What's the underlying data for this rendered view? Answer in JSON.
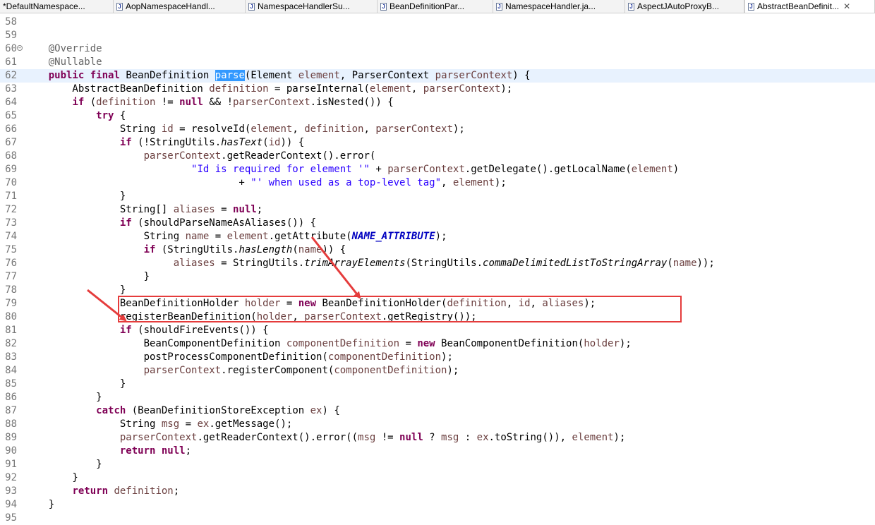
{
  "tabs": [
    {
      "label": "*DefaultNamespace...",
      "active": false,
      "icon": "java-file-icon"
    },
    {
      "label": "AopNamespaceHandl...",
      "active": false,
      "icon": "java-file-icon"
    },
    {
      "label": "NamespaceHandlerSu...",
      "active": false,
      "icon": "java-file-icon"
    },
    {
      "label": "BeanDefinitionPar...",
      "active": false,
      "icon": "java-file-icon"
    },
    {
      "label": "NamespaceHandler.ja...",
      "active": false,
      "icon": "java-file-icon"
    },
    {
      "label": "AspectJAutoProxyB...",
      "active": false,
      "icon": "java-file-icon"
    },
    {
      "label": "AbstractBeanDefinit...",
      "active": true,
      "icon": "java-file-icon",
      "close": "✕"
    }
  ],
  "colors": {
    "keyword": "#7f0055",
    "annotation": "#646464",
    "string": "#2a00ff",
    "field_constant": "#0000c0",
    "selection": "#3399ff",
    "current_line": "#e8f2fe",
    "highlight_box": "#e53c3c",
    "arrow": "#e53c3c"
  },
  "fold_marker": {
    "line": "60",
    "glyph": "−"
  },
  "selected_token": "parse",
  "current_line": "62",
  "highlight_box_lines": [
    "79",
    "80"
  ],
  "code_lines": [
    {
      "n": "58",
      "segs": []
    },
    {
      "n": "59",
      "segs": []
    },
    {
      "n": "60",
      "segs": [
        {
          "t": "    "
        },
        {
          "t": "@Override",
          "c": "ann"
        }
      ]
    },
    {
      "n": "61",
      "segs": [
        {
          "t": "    "
        },
        {
          "t": "@Nullable",
          "c": "ann"
        }
      ]
    },
    {
      "n": "62",
      "segs": [
        {
          "t": "    "
        },
        {
          "t": "public",
          "c": "kw"
        },
        {
          "t": " "
        },
        {
          "t": "final",
          "c": "kw"
        },
        {
          "t": " BeanDefinition "
        },
        {
          "t": "parse",
          "c": "sel"
        },
        {
          "t": "(Element "
        },
        {
          "t": "element",
          "c": "vr"
        },
        {
          "t": ", ParserContext "
        },
        {
          "t": "parserContext",
          "c": "vr"
        },
        {
          "t": ") {"
        }
      ]
    },
    {
      "n": "63",
      "segs": [
        {
          "t": "        AbstractBeanDefinition "
        },
        {
          "t": "definition",
          "c": "vr"
        },
        {
          "t": " = parseInternal("
        },
        {
          "t": "element",
          "c": "vr"
        },
        {
          "t": ", "
        },
        {
          "t": "parserContext",
          "c": "vr"
        },
        {
          "t": ");"
        }
      ]
    },
    {
      "n": "64",
      "segs": [
        {
          "t": "        "
        },
        {
          "t": "if",
          "c": "kw"
        },
        {
          "t": " ("
        },
        {
          "t": "definition",
          "c": "vr"
        },
        {
          "t": " != "
        },
        {
          "t": "null",
          "c": "kw"
        },
        {
          "t": " && !"
        },
        {
          "t": "parserContext",
          "c": "vr"
        },
        {
          "t": ".isNested()) {"
        }
      ]
    },
    {
      "n": "65",
      "segs": [
        {
          "t": "            "
        },
        {
          "t": "try",
          "c": "kw"
        },
        {
          "t": " {"
        }
      ]
    },
    {
      "n": "66",
      "segs": [
        {
          "t": "                String "
        },
        {
          "t": "id",
          "c": "vr"
        },
        {
          "t": " = resolveId("
        },
        {
          "t": "element",
          "c": "vr"
        },
        {
          "t": ", "
        },
        {
          "t": "definition",
          "c": "vr"
        },
        {
          "t": ", "
        },
        {
          "t": "parserContext",
          "c": "vr"
        },
        {
          "t": ");"
        }
      ]
    },
    {
      "n": "67",
      "segs": [
        {
          "t": "                "
        },
        {
          "t": "if",
          "c": "kw"
        },
        {
          "t": " (!StringUtils."
        },
        {
          "t": "hasText",
          "c": "it"
        },
        {
          "t": "("
        },
        {
          "t": "id",
          "c": "vr"
        },
        {
          "t": ")) {"
        }
      ]
    },
    {
      "n": "68",
      "segs": [
        {
          "t": "                    "
        },
        {
          "t": "parserContext",
          "c": "vr"
        },
        {
          "t": ".getReaderContext().error("
        }
      ]
    },
    {
      "n": "69",
      "segs": [
        {
          "t": "                            "
        },
        {
          "t": "\"Id is required for element '\"",
          "c": "str"
        },
        {
          "t": " + "
        },
        {
          "t": "parserContext",
          "c": "vr"
        },
        {
          "t": ".getDelegate().getLocalName("
        },
        {
          "t": "element",
          "c": "vr"
        },
        {
          "t": ")"
        }
      ]
    },
    {
      "n": "70",
      "segs": [
        {
          "t": "                                    + "
        },
        {
          "t": "\"' when used as a top-level tag\"",
          "c": "str"
        },
        {
          "t": ", "
        },
        {
          "t": "element",
          "c": "vr"
        },
        {
          "t": ");"
        }
      ]
    },
    {
      "n": "71",
      "segs": [
        {
          "t": "                }"
        }
      ]
    },
    {
      "n": "72",
      "segs": [
        {
          "t": "                String[] "
        },
        {
          "t": "aliases",
          "c": "vr"
        },
        {
          "t": " = "
        },
        {
          "t": "null",
          "c": "kw"
        },
        {
          "t": ";"
        }
      ]
    },
    {
      "n": "73",
      "segs": [
        {
          "t": "                "
        },
        {
          "t": "if",
          "c": "kw"
        },
        {
          "t": " (shouldParseNameAsAliases()) {"
        }
      ]
    },
    {
      "n": "74",
      "segs": [
        {
          "t": "                    String "
        },
        {
          "t": "name",
          "c": "vr"
        },
        {
          "t": " = "
        },
        {
          "t": "element",
          "c": "vr"
        },
        {
          "t": ".getAttribute("
        },
        {
          "t": "NAME_ATTRIBUTE",
          "c": "const"
        },
        {
          "t": ");"
        }
      ]
    },
    {
      "n": "75",
      "segs": [
        {
          "t": "                    "
        },
        {
          "t": "if",
          "c": "kw"
        },
        {
          "t": " (StringUtils."
        },
        {
          "t": "hasLength",
          "c": "it"
        },
        {
          "t": "("
        },
        {
          "t": "name",
          "c": "vr"
        },
        {
          "t": ")) {"
        }
      ]
    },
    {
      "n": "76",
      "segs": [
        {
          "t": "                         "
        },
        {
          "t": "aliases",
          "c": "vr"
        },
        {
          "t": " = StringUtils."
        },
        {
          "t": "trimArrayElements",
          "c": "it"
        },
        {
          "t": "(StringUtils."
        },
        {
          "t": "commaDelimitedListToStringArray",
          "c": "it"
        },
        {
          "t": "("
        },
        {
          "t": "name",
          "c": "vr"
        },
        {
          "t": "));"
        }
      ]
    },
    {
      "n": "77",
      "segs": [
        {
          "t": "                    }"
        }
      ]
    },
    {
      "n": "78",
      "segs": [
        {
          "t": "                }"
        }
      ]
    },
    {
      "n": "79",
      "segs": [
        {
          "t": "                BeanDefinitionHolder "
        },
        {
          "t": "holder",
          "c": "vr"
        },
        {
          "t": " = "
        },
        {
          "t": "new",
          "c": "kw"
        },
        {
          "t": " BeanDefinitionHolder("
        },
        {
          "t": "definition",
          "c": "vr"
        },
        {
          "t": ", "
        },
        {
          "t": "id",
          "c": "vr"
        },
        {
          "t": ", "
        },
        {
          "t": "aliases",
          "c": "vr"
        },
        {
          "t": ");"
        }
      ]
    },
    {
      "n": "80",
      "segs": [
        {
          "t": "                registerBeanDefinition("
        },
        {
          "t": "holder",
          "c": "vr"
        },
        {
          "t": ", "
        },
        {
          "t": "parserContext",
          "c": "vr"
        },
        {
          "t": ".getRegistry());"
        }
      ]
    },
    {
      "n": "81",
      "segs": [
        {
          "t": "                "
        },
        {
          "t": "if",
          "c": "kw"
        },
        {
          "t": " (shouldFireEvents()) {"
        }
      ]
    },
    {
      "n": "82",
      "segs": [
        {
          "t": "                    BeanComponentDefinition "
        },
        {
          "t": "componentDefinition",
          "c": "vr"
        },
        {
          "t": " = "
        },
        {
          "t": "new",
          "c": "kw"
        },
        {
          "t": " BeanComponentDefinition("
        },
        {
          "t": "holder",
          "c": "vr"
        },
        {
          "t": ");"
        }
      ]
    },
    {
      "n": "83",
      "segs": [
        {
          "t": "                    postProcessComponentDefinition("
        },
        {
          "t": "componentDefinition",
          "c": "vr"
        },
        {
          "t": ");"
        }
      ]
    },
    {
      "n": "84",
      "segs": [
        {
          "t": "                    "
        },
        {
          "t": "parserContext",
          "c": "vr"
        },
        {
          "t": ".registerComponent("
        },
        {
          "t": "componentDefinition",
          "c": "vr"
        },
        {
          "t": ");"
        }
      ]
    },
    {
      "n": "85",
      "segs": [
        {
          "t": "                }"
        }
      ]
    },
    {
      "n": "86",
      "segs": [
        {
          "t": "            }"
        }
      ]
    },
    {
      "n": "87",
      "segs": [
        {
          "t": "            "
        },
        {
          "t": "catch",
          "c": "kw"
        },
        {
          "t": " (BeanDefinitionStoreException "
        },
        {
          "t": "ex",
          "c": "vr"
        },
        {
          "t": ") {"
        }
      ]
    },
    {
      "n": "88",
      "segs": [
        {
          "t": "                String "
        },
        {
          "t": "msg",
          "c": "vr"
        },
        {
          "t": " = "
        },
        {
          "t": "ex",
          "c": "vr"
        },
        {
          "t": ".getMessage();"
        }
      ]
    },
    {
      "n": "89",
      "segs": [
        {
          "t": "                "
        },
        {
          "t": "parserContext",
          "c": "vr"
        },
        {
          "t": ".getReaderContext().error(("
        },
        {
          "t": "msg",
          "c": "vr"
        },
        {
          "t": " != "
        },
        {
          "t": "null",
          "c": "kw"
        },
        {
          "t": " ? "
        },
        {
          "t": "msg",
          "c": "vr"
        },
        {
          "t": " : "
        },
        {
          "t": "ex",
          "c": "vr"
        },
        {
          "t": ".toString()), "
        },
        {
          "t": "element",
          "c": "vr"
        },
        {
          "t": ");"
        }
      ]
    },
    {
      "n": "90",
      "segs": [
        {
          "t": "                "
        },
        {
          "t": "return",
          "c": "kw"
        },
        {
          "t": " "
        },
        {
          "t": "null",
          "c": "kw"
        },
        {
          "t": ";"
        }
      ]
    },
    {
      "n": "91",
      "segs": [
        {
          "t": "            }"
        }
      ]
    },
    {
      "n": "92",
      "segs": [
        {
          "t": "        }"
        }
      ]
    },
    {
      "n": "93",
      "segs": [
        {
          "t": "        "
        },
        {
          "t": "return",
          "c": "kw"
        },
        {
          "t": " "
        },
        {
          "t": "definition",
          "c": "vr"
        },
        {
          "t": ";"
        }
      ]
    },
    {
      "n": "94",
      "segs": [
        {
          "t": "    }"
        }
      ]
    },
    {
      "n": "95",
      "segs": []
    }
  ]
}
